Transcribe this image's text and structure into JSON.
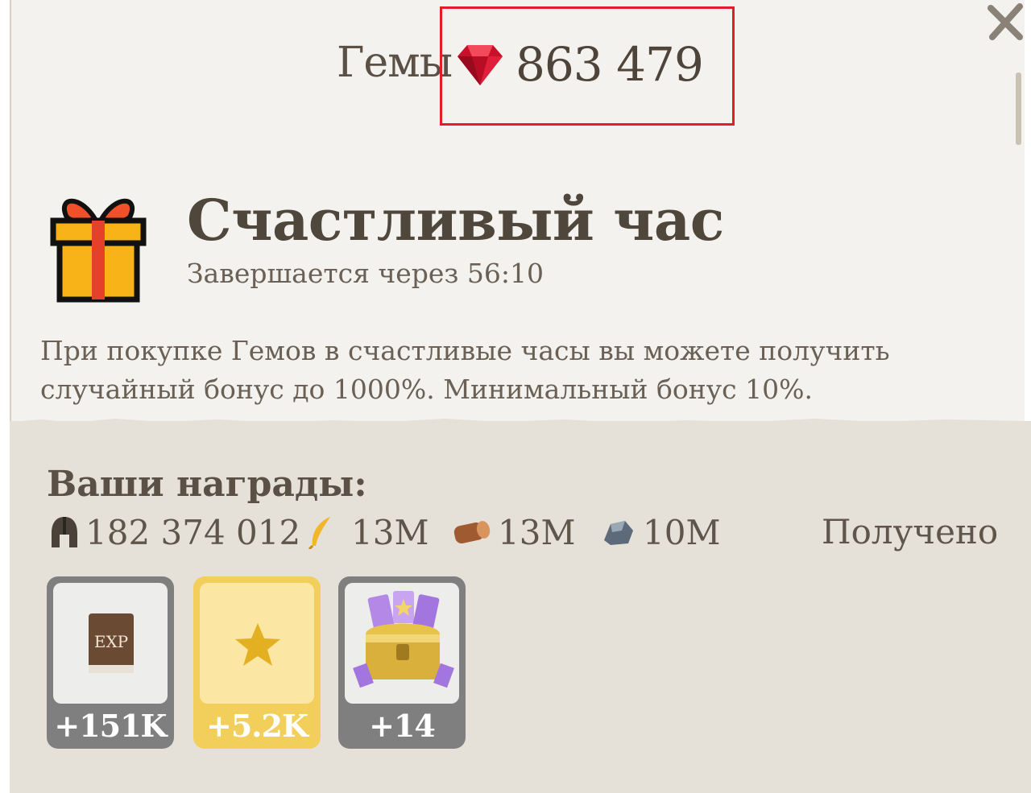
{
  "header": {
    "gems_label": "Гемы",
    "gems_value": "863 479"
  },
  "event": {
    "title": "Счастливый час",
    "timer": "Завершается через 56:10",
    "description": "При покупке Гемов в счастливые часы вы можете получить случайный бонус до 1000%. Минимальный бонус 10%."
  },
  "rewards": {
    "title": "Ваши награды:",
    "resources": [
      {
        "icon": "spartan-helmet-icon",
        "value": "182 374 012"
      },
      {
        "icon": "feather-icon",
        "value": "13M"
      },
      {
        "icon": "wood-log-icon",
        "value": "13M"
      },
      {
        "icon": "stone-icon",
        "value": "10M"
      }
    ],
    "status": "Получено",
    "cards": [
      {
        "icon": "exp-book-icon",
        "icon_text": "EXP",
        "amount": "+151K",
        "style": "grey"
      },
      {
        "icon": "star-icon",
        "amount": "+5.2K",
        "style": "gold"
      },
      {
        "icon": "treasure-chest-icon",
        "amount": "+14",
        "style": "grey"
      }
    ]
  },
  "colors": {
    "highlight": "#e01d2a",
    "gem": "#d1112a",
    "panel_bg": "#f4f2ee",
    "rewards_bg": "#e5e0d8",
    "gold_card": "#f2cf5a"
  }
}
